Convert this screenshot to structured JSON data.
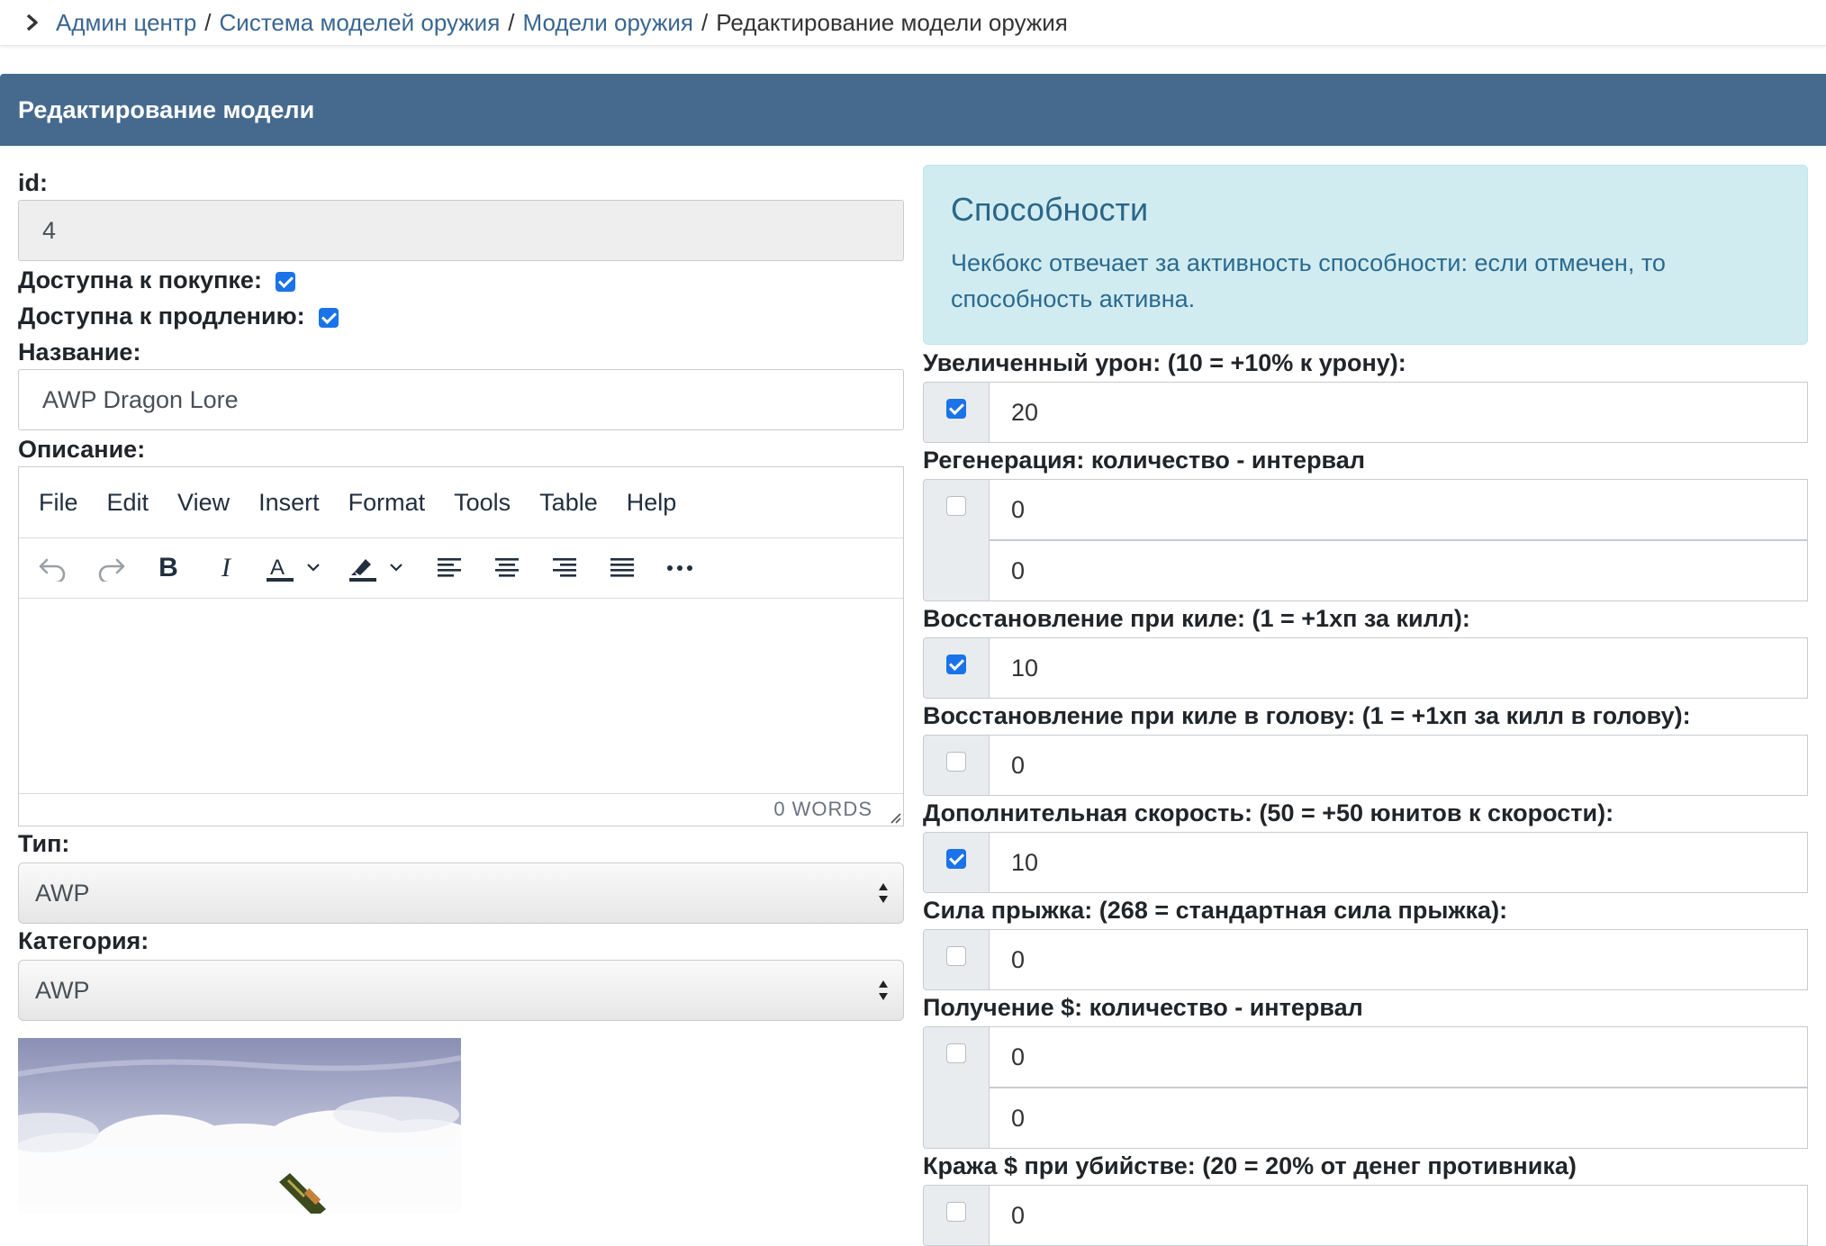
{
  "breadcrumb": {
    "items": [
      "Админ центр",
      "Система моделей оружия",
      "Модели оружия"
    ],
    "separator": "/",
    "current": "Редактирование модели оружия"
  },
  "card": {
    "title": "Редактирование модели"
  },
  "form": {
    "id_label": "id:",
    "id_value": "4",
    "buy_label": "Доступна к покупке:",
    "buy_checked": true,
    "renew_label": "Доступна к продлению:",
    "renew_checked": true,
    "name_label": "Название:",
    "name_value": "AWP Dragon Lore",
    "desc_label": "Описание:",
    "type_label": "Тип:",
    "type_value": "AWP",
    "category_label": "Категория:",
    "category_value": "AWP"
  },
  "editor": {
    "menu": [
      "File",
      "Edit",
      "View",
      "Insert",
      "Format",
      "Tools",
      "Table",
      "Help"
    ],
    "toolbar_icons": [
      "undo-icon",
      "redo-icon",
      "bold-icon",
      "italic-icon",
      "text-color-icon",
      "highlight-icon",
      "align-left-icon",
      "align-center-icon",
      "align-right-icon",
      "align-justify-icon",
      "more-icon"
    ],
    "word_count": "0 WORDS"
  },
  "alert": {
    "title": "Способности",
    "text": "Чекбокс отвечает за активность способности: если отмечен, то способность активна."
  },
  "abilities": [
    {
      "label": "Увеличенный урон: (10 = +10% к урону):",
      "checked": true,
      "values": [
        "20"
      ]
    },
    {
      "label": "Регенерация: количество - интервал",
      "checked": false,
      "values": [
        "0",
        "0"
      ]
    },
    {
      "label": "Восстановление при киле: (1 = +1хп за килл):",
      "checked": true,
      "values": [
        "10"
      ]
    },
    {
      "label": "Восстановление при киле в голову: (1 = +1хп за килл в голову):",
      "checked": false,
      "values": [
        "0"
      ]
    },
    {
      "label": "Дополнительная скорость: (50 = +50 юнитов к скорости):",
      "checked": true,
      "values": [
        "10"
      ]
    },
    {
      "label": "Сила прыжка: (268 = стандартная сила прыжка):",
      "checked": false,
      "values": [
        "0"
      ]
    },
    {
      "label": "Получение $: количество - интервал",
      "checked": false,
      "values": [
        "0",
        "0"
      ]
    },
    {
      "label": "Кража $ при убийстве: (20 = 20% от денег противника)",
      "checked": false,
      "values": [
        "0"
      ]
    }
  ],
  "colors": {
    "header_bg": "#466a8e",
    "link": "#3a6690",
    "alert_bg": "#d1ecf1",
    "checkbox_on": "#1a73e8"
  }
}
